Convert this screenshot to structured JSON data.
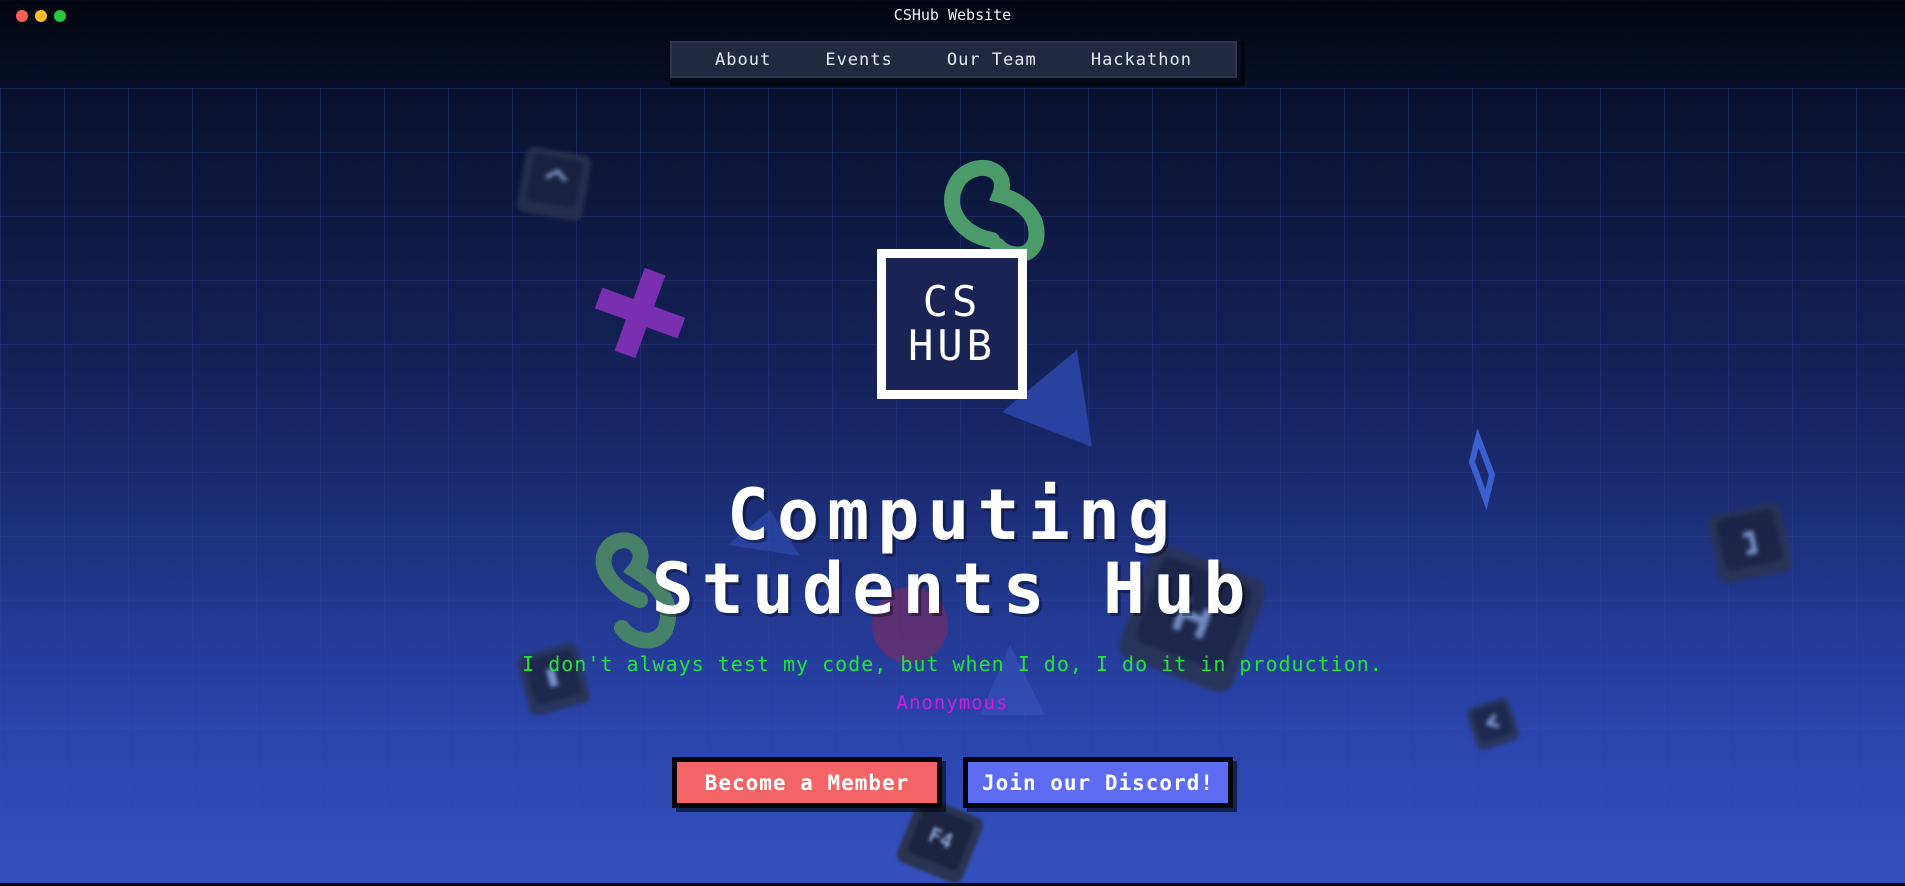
{
  "window": {
    "title": "CSHub Website"
  },
  "nav": {
    "items": [
      "About",
      "Events",
      "Our Team",
      "Hackathon"
    ]
  },
  "logo": {
    "line1": "CS",
    "line2": "HUB"
  },
  "hero": {
    "title_line1": "Computing",
    "title_line2": "Students Hub",
    "quote": "I don't always test my code, but when I do, I do it in production.",
    "author": "Anonymous"
  },
  "buttons": {
    "member": "Become a Member",
    "discord": "Join our Discord!"
  },
  "keycaps": [
    "F4"
  ],
  "colors": {
    "quote": "#22e53a",
    "author": "#d21ddc",
    "member_button": "#f36466",
    "discord_button": "#5d6cf0",
    "accent_green_squiggle": "#4a9a6a",
    "accent_purple_cross": "#7a2fb0"
  }
}
